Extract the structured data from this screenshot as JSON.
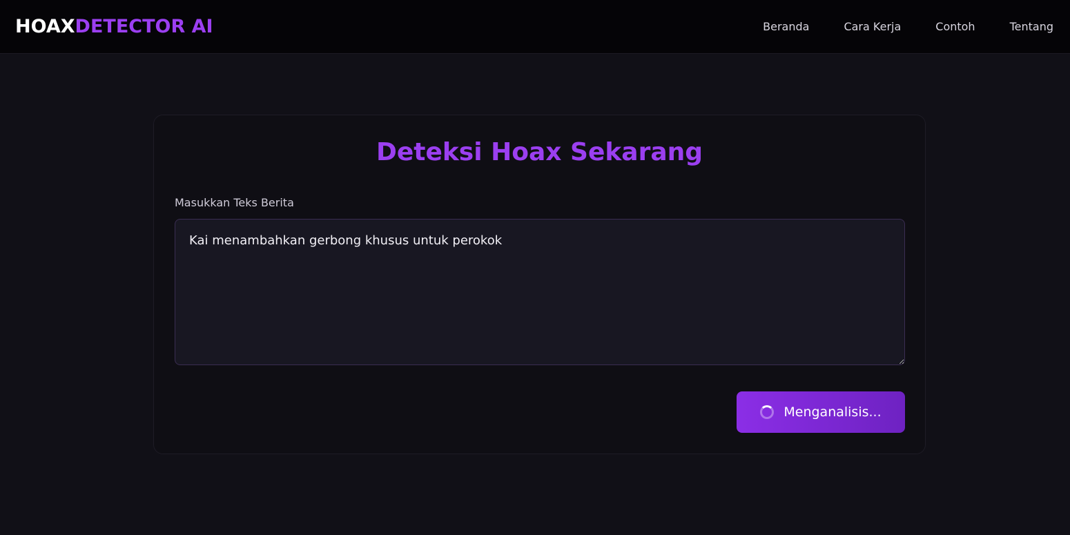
{
  "header": {
    "logo_part1": "HOAX",
    "logo_part2": "DETECTOR AI",
    "nav": [
      {
        "label": "Beranda"
      },
      {
        "label": "Cara Kerja"
      },
      {
        "label": "Contoh"
      },
      {
        "label": "Tentang"
      }
    ]
  },
  "main": {
    "title": "Deteksi Hoax Sekarang",
    "input_label": "Masukkan Teks Berita",
    "input_value": "Kai menambahkan gerbong khusus untuk perokok",
    "button_label": "Menganalisis..."
  },
  "colors": {
    "accent": "#9b3ff0",
    "button_start": "#8b2ee6",
    "button_end": "#6e22c2",
    "background": "#111017"
  },
  "icons": {
    "button_icon": "loading-spinner-icon"
  }
}
